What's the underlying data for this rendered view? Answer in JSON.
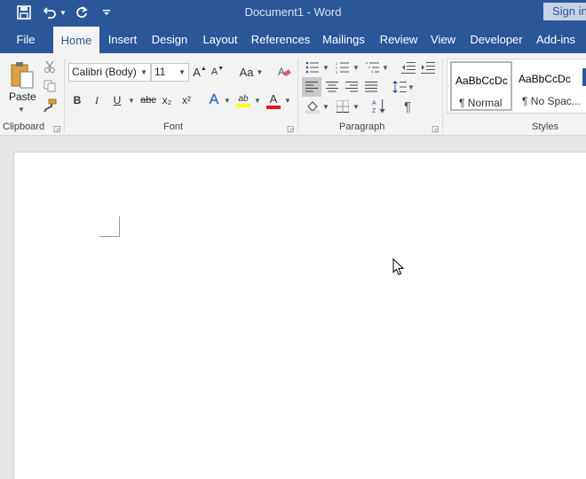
{
  "titlebar": {
    "save_icon": "save-icon",
    "undo_icon": "undo-icon",
    "redo_icon": "redo-icon",
    "customize_icon": "customize-quick-access-icon",
    "document_title": "Document1  -  Word",
    "sign_in_label": "Sign in"
  },
  "tabs": [
    {
      "label": "File"
    },
    {
      "label": "Home"
    },
    {
      "label": "Insert"
    },
    {
      "label": "Design"
    },
    {
      "label": "Layout"
    },
    {
      "label": "References"
    },
    {
      "label": "Mailings"
    },
    {
      "label": "Review"
    },
    {
      "label": "View"
    },
    {
      "label": "Developer"
    },
    {
      "label": "Add-ins"
    }
  ],
  "active_tab": "Home",
  "ribbon": {
    "clipboard": {
      "label": "Clipboard",
      "paste_label": "Paste"
    },
    "font": {
      "label": "Font",
      "font_name": "Calibri (Body)",
      "font_size": "11",
      "grow_label": "A",
      "shrink_label": "A",
      "case_label": "Aa",
      "bold": "B",
      "italic": "I",
      "underline": "U",
      "strike": "abc",
      "subscript": "x₂",
      "superscript": "x²",
      "effects": "A",
      "highlight": "ab",
      "font_color": "A"
    },
    "paragraph": {
      "label": "Paragraph",
      "pilcrow": "¶"
    },
    "styles": {
      "label": "Styles",
      "items": [
        {
          "sample": "AaBbCcDc",
          "name": "¶ Normal"
        },
        {
          "sample": "AaBbCcDc",
          "name": "¶ No Spac..."
        }
      ]
    }
  },
  "colors": {
    "brand_blue": "#2b579a",
    "highlight_yellow": "#ffff00",
    "font_red": "#e01a1a"
  }
}
